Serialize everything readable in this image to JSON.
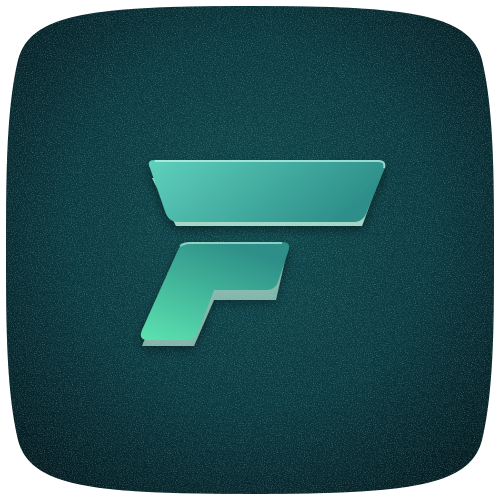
{
  "icon": {
    "name": "app-icon",
    "glyph": "f-logo-icon",
    "colors": {
      "background_center": "#0d4a4f",
      "background_edge": "#041a20",
      "speckle_light": "#7fb8b0",
      "speckle_dark": "#020c10",
      "logo_top_light": "#5fd1bd",
      "logo_top_dark": "#2e8f8a",
      "logo_bottom_light": "#5ce3b0",
      "logo_bottom_dark": "#2d8f88",
      "logo_edge_highlight": "#bff5e3"
    }
  }
}
